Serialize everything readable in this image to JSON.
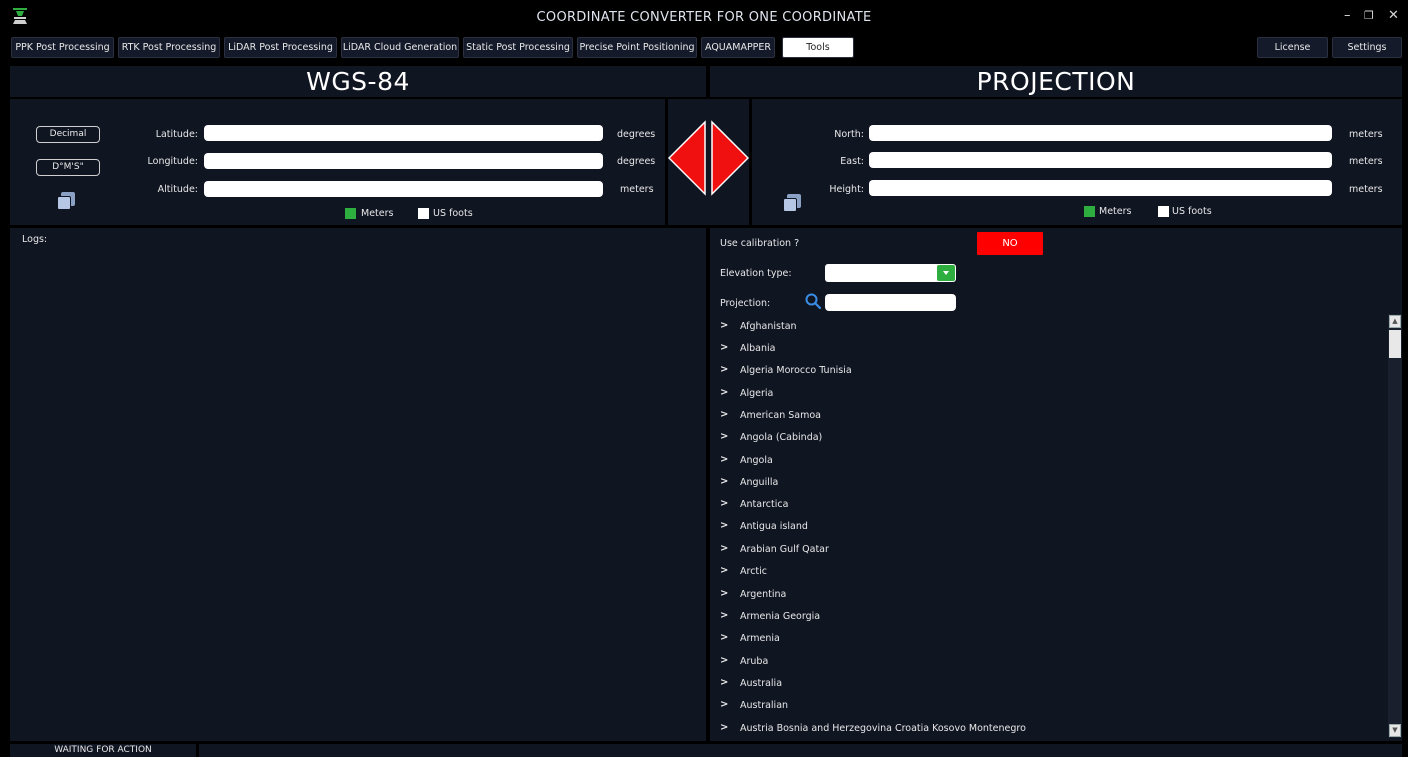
{
  "window": {
    "title": "COORDINATE CONVERTER FOR ONE COORDINATE",
    "controls": {
      "minimize": "–",
      "restore": "❐",
      "close": "✕"
    }
  },
  "tabs": [
    {
      "label": "PPK Post Processing"
    },
    {
      "label": "RTK Post Processing"
    },
    {
      "label": "LiDAR Post Processing"
    },
    {
      "label": "LiDAR Cloud Generation"
    },
    {
      "label": "Static Post Processing"
    },
    {
      "label": "Precise Point Positioning"
    },
    {
      "label": "AQUAMAPPER"
    },
    {
      "label": "Tools",
      "active": true
    },
    {
      "label": "License"
    },
    {
      "label": "Settings"
    }
  ],
  "wgs84": {
    "heading": "WGS-84",
    "decimal_button": "Decimal",
    "dms_button": "D°M'S\"",
    "latitude_label": "Latitude:",
    "latitude_value": "",
    "latitude_unit": "degrees",
    "longitude_label": "Longitude:",
    "longitude_value": "",
    "longitude_unit": "degrees",
    "altitude_label": "Altitude:",
    "altitude_value": "",
    "altitude_unit": "meters",
    "meters_label": "Meters",
    "usfoots_label": "US foots"
  },
  "projection_panel": {
    "heading": "PROJECTION",
    "north_label": "North:",
    "north_value": "",
    "north_unit": "meters",
    "east_label": "East:",
    "east_value": "",
    "east_unit": "meters",
    "height_label": "Height:",
    "height_value": "",
    "height_unit": "meters",
    "meters_label": "Meters",
    "usfoots_label": "US foots"
  },
  "logs": {
    "label": "Logs:"
  },
  "settings": {
    "calibration_label": "Use calibration ?",
    "calibration_value": "NO",
    "elevation_label": "Elevation type:",
    "elevation_value": "",
    "projection_label": "Projection:",
    "projection_search": ""
  },
  "projection_list": [
    "Afghanistan",
    "Albania",
    "Algeria Morocco Tunisia",
    "Algeria",
    "American Samoa",
    "Angola (Cabinda)",
    "Angola",
    "Anguilla",
    "Antarctica",
    "Antigua island",
    "Arabian Gulf Qatar",
    "Arctic",
    "Argentina",
    "Armenia Georgia",
    "Armenia",
    "Aruba",
    "Australia",
    "Australian",
    "Austria Bosnia and Herzegovina Croatia Kosovo Montenegro"
  ],
  "status": {
    "text": "WAITING FOR ACTION"
  },
  "colors": {
    "panel": "#101522",
    "accent_green": "#2fae40",
    "danger_red": "#ff0000",
    "search_icon": "#3a8ee6"
  }
}
